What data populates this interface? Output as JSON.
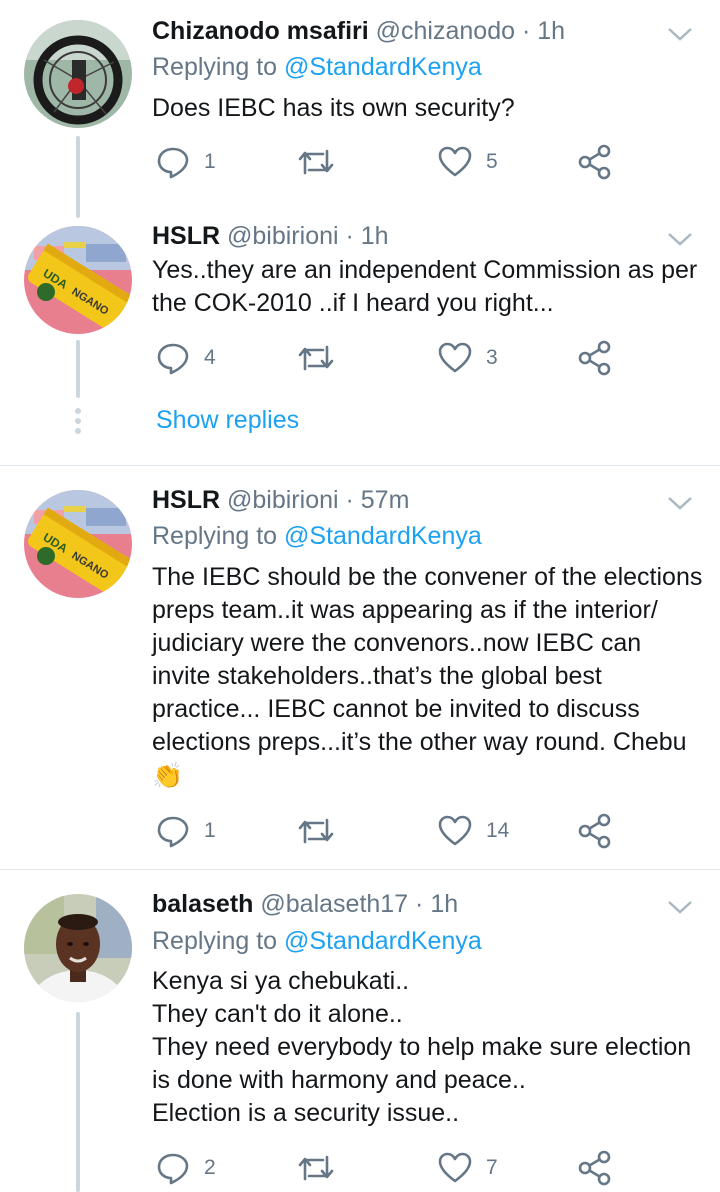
{
  "tweets": [
    {
      "name": "Chizanodo msafiri",
      "handle": "@chizanodo",
      "sep": " · ",
      "time": "1h",
      "replying_prefix": "Replying to ",
      "replying_to": "@StandardKenya",
      "text": "Does IEBC has its own security?",
      "replies": "1",
      "retweets": "",
      "likes": "5",
      "avatar": "bicycle-wheel"
    },
    {
      "name": "HSLR",
      "handle": "@bibirioni",
      "sep": " · ",
      "time": "1h",
      "text": "Yes..they are an independent Commission as per\nthe COK-2010 ..if I heard you right...",
      "replies": "4",
      "retweets": "",
      "likes": "3",
      "avatar": "uda-wheelbarrow",
      "avatar_text": "UDA NGANO"
    },
    {
      "name": "HSLR",
      "handle": "@bibirioni",
      "sep": " · ",
      "time": "57m",
      "replying_prefix": "Replying to ",
      "replying_to": "@StandardKenya",
      "text": "The IEBC should be the convener of the elections\npreps team..it was appearing as if the interior/\njudiciary were the convenors..now IEBC can\ninvite stakeholders..that’s the global best\npractice... IEBC cannot be invited to discuss\nelections preps...it’s the other way round. Chebu",
      "emoji": "👏",
      "replies": "1",
      "retweets": "",
      "likes": "14",
      "avatar": "uda-wheelbarrow",
      "avatar_text": "UDA NGANO"
    },
    {
      "name": "balaseth",
      "handle": "@balaseth17",
      "sep": " · ",
      "time": "1h",
      "replying_prefix": "Replying to ",
      "replying_to": "@StandardKenya",
      "text": "Kenya si ya chebukati..\nThey can't do it alone..\nThey need everybody to help make sure election\nis done with harmony and peace..\nElection is a security issue..",
      "replies": "2",
      "retweets": "",
      "likes": "7",
      "avatar": "person-photo"
    }
  ],
  "show_replies_label": "Show replies",
  "colors": {
    "link": "#1da1f2",
    "secondary": "#657786",
    "thread_line": "#ccd6dd",
    "divider": "#e1e8ed"
  },
  "icons": {
    "reply": "reply-icon",
    "retweet": "retweet-icon",
    "like": "like-icon",
    "share": "share-icon",
    "caret": "chevron-down-icon"
  }
}
